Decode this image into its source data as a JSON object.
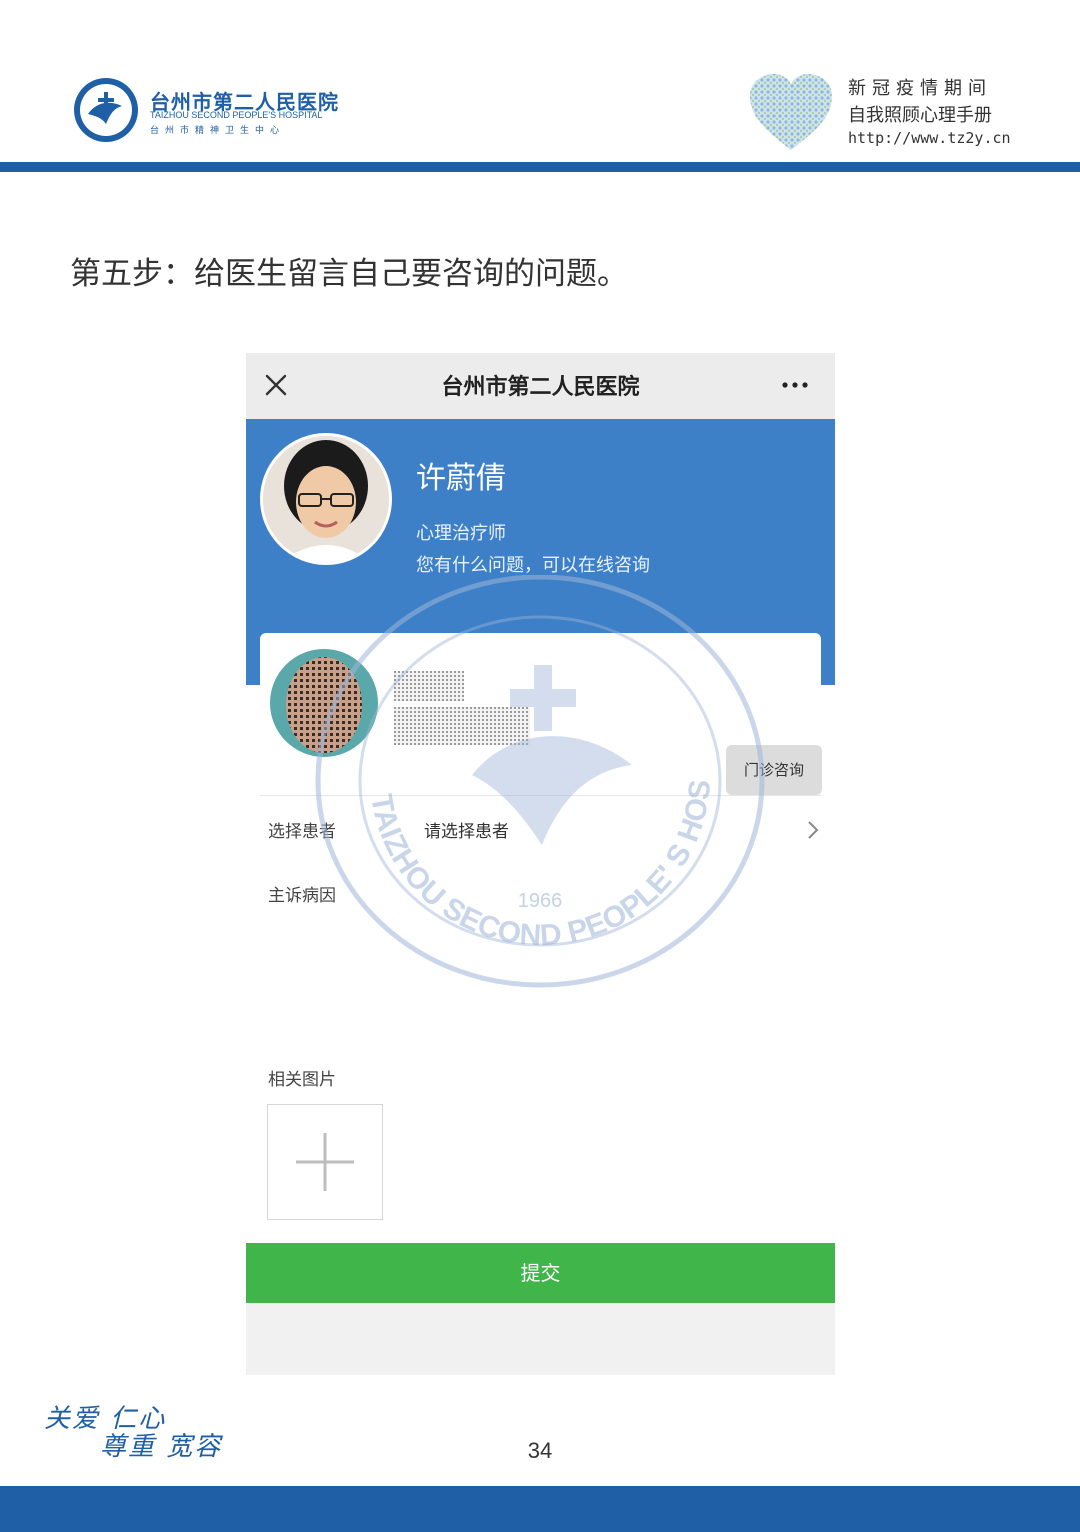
{
  "header": {
    "hospital_name_cn": "台州市第二人民医院",
    "hospital_name_en": "TAIZHOU SECOND PEOPLE'S HOSPITAL",
    "hospital_sub_cn": "台州市精神卫生中心",
    "handbook_line1": "新冠疫情期间",
    "handbook_line2": "自我照顾心理手册",
    "handbook_url": "http://www.tz2y.cn"
  },
  "step_title": "第五步：给医生留言自己要咨询的问题。",
  "phone": {
    "nav_title": "台州市第二人民医院",
    "doctor": {
      "name": "许蔚倩",
      "title": "心理治疗师",
      "description": "您有什么问题，可以在线咨询"
    },
    "outpatient_button": "门诊咨询",
    "select_patient_label": "选择患者",
    "select_patient_value": "请选择患者",
    "complaint_label": "主诉病因",
    "photos_label": "相关图片",
    "submit_label": "提交"
  },
  "seal": {
    "year": "1966",
    "english_text": "TAIZHOU SECOND PEOPLE' S HOSPITAL"
  },
  "footer": {
    "motto_line1": "关爱 仁心",
    "motto_line2": "尊重 宽容",
    "page_number": "34"
  },
  "colors": {
    "brand_blue": "#1f5fa5",
    "doctor_card_blue": "#3d80c8",
    "submit_green": "#3fb54a"
  },
  "icons": [
    "hospital-logo-icon",
    "heart-mosaic-icon",
    "close-icon",
    "more-icon",
    "chevron-right-icon",
    "plus-icon"
  ]
}
